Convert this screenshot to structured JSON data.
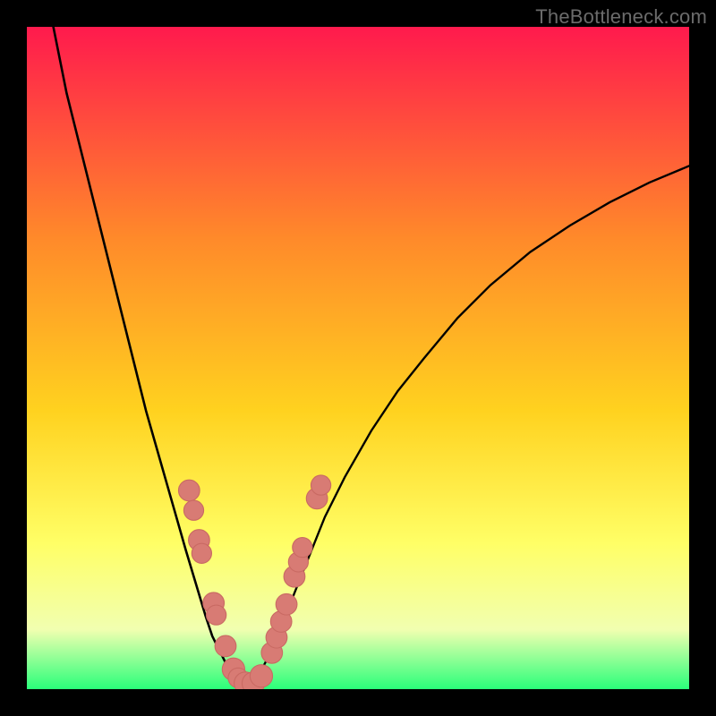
{
  "watermark": "TheBottleneck.com",
  "colors": {
    "frame": "#000000",
    "gradient_top": "#ff1a4d",
    "gradient_mid1": "#ff6a2a",
    "gradient_mid2": "#ffd21f",
    "gradient_mid3": "#ffff66",
    "gradient_mid4": "#f1ffb0",
    "gradient_bottom": "#2aff7a",
    "curve_stroke": "#000000",
    "marker_fill": "#d87b74",
    "marker_stroke": "#c96a63"
  },
  "chart_data": {
    "type": "line",
    "title": "",
    "xlabel": "",
    "ylabel": "",
    "xlim": [
      0,
      100
    ],
    "ylim": [
      0,
      100
    ],
    "note": "Axis values are fractional coordinates (0–100) inside the plot area; the source chart has no numeric tick labels.",
    "series": [
      {
        "name": "left-curve",
        "x": [
          4,
          5,
          6,
          8,
          10,
          12,
          14,
          16,
          18,
          20,
          22,
          24,
          25.5,
          27,
          28,
          29,
          30,
          31,
          32,
          33
        ],
        "y": [
          100,
          95,
          90,
          82,
          74,
          66,
          58,
          50,
          42,
          35,
          28,
          21,
          16,
          11,
          8,
          6,
          4,
          2.5,
          1.2,
          0.4
        ]
      },
      {
        "name": "right-curve",
        "x": [
          33,
          34,
          35,
          36,
          37.5,
          39,
          41,
          43,
          45,
          48,
          52,
          56,
          60,
          65,
          70,
          76,
          82,
          88,
          94,
          100
        ],
        "y": [
          0.4,
          1.0,
          2.2,
          4.0,
          7.0,
          11,
          16,
          21,
          26,
          32,
          39,
          45,
          50,
          56,
          61,
          66,
          70,
          73.5,
          76.5,
          79
        ]
      }
    ],
    "markers": {
      "name": "highlighted-points",
      "points": [
        {
          "x": 24.5,
          "y": 30,
          "r": 1.6
        },
        {
          "x": 25.2,
          "y": 27,
          "r": 1.5
        },
        {
          "x": 26.0,
          "y": 22.5,
          "r": 1.6
        },
        {
          "x": 26.4,
          "y": 20.5,
          "r": 1.5
        },
        {
          "x": 28.2,
          "y": 13,
          "r": 1.6
        },
        {
          "x": 28.6,
          "y": 11.2,
          "r": 1.5
        },
        {
          "x": 30.0,
          "y": 6.5,
          "r": 1.6
        },
        {
          "x": 31.2,
          "y": 3.0,
          "r": 1.7
        },
        {
          "x": 31.9,
          "y": 1.7,
          "r": 1.5
        },
        {
          "x": 33.0,
          "y": 0.9,
          "r": 1.7
        },
        {
          "x": 34.2,
          "y": 0.9,
          "r": 1.7
        },
        {
          "x": 35.4,
          "y": 2.0,
          "r": 1.7
        },
        {
          "x": 37.0,
          "y": 5.5,
          "r": 1.6
        },
        {
          "x": 37.7,
          "y": 7.8,
          "r": 1.6
        },
        {
          "x": 38.4,
          "y": 10.2,
          "r": 1.6
        },
        {
          "x": 39.2,
          "y": 12.8,
          "r": 1.6
        },
        {
          "x": 40.4,
          "y": 17.0,
          "r": 1.6
        },
        {
          "x": 41.0,
          "y": 19.2,
          "r": 1.5
        },
        {
          "x": 41.6,
          "y": 21.4,
          "r": 1.5
        },
        {
          "x": 43.8,
          "y": 28.8,
          "r": 1.6
        },
        {
          "x": 44.4,
          "y": 30.8,
          "r": 1.5
        }
      ]
    }
  }
}
